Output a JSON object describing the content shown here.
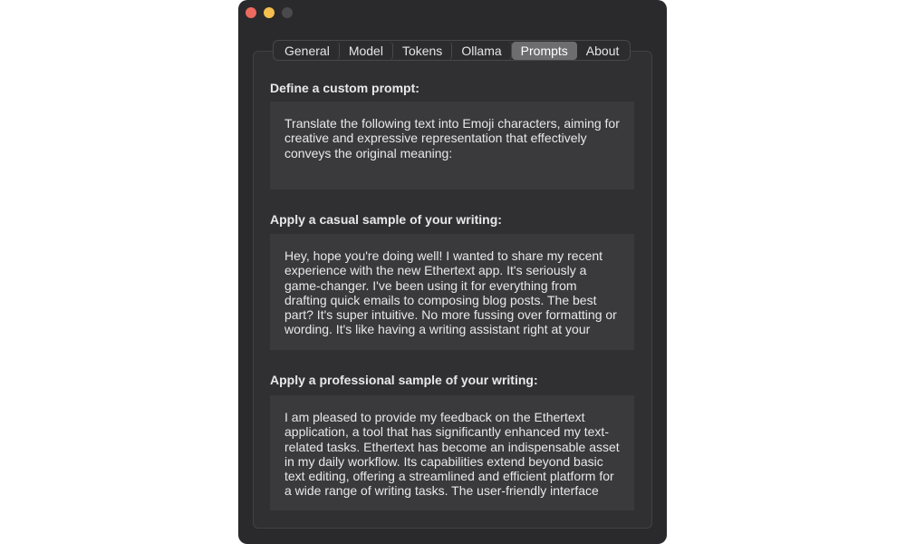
{
  "window": {
    "traffic_lights": [
      "close",
      "minimize",
      "zoom"
    ]
  },
  "tabs": [
    {
      "label": "General",
      "active": false
    },
    {
      "label": "Model",
      "active": false
    },
    {
      "label": "Tokens",
      "active": false
    },
    {
      "label": "Ollama",
      "active": false
    },
    {
      "label": "Prompts",
      "active": true
    },
    {
      "label": "About",
      "active": false
    }
  ],
  "sections": {
    "custom": {
      "label": "Define a custom prompt:",
      "text": "Translate the following text into Emoji characters, aiming for creative and expressive representation that effectively conveys the original meaning:"
    },
    "casual": {
      "label": "Apply a casual sample of your writing:",
      "text": "Hey, hope you're doing well! I wanted to share my recent experience with the new Ethertext app. It's seriously a game-changer. I've been using it for everything from drafting quick emails to composing blog posts. The best part? It's super intuitive. No more fussing over formatting or wording. It's like having a writing assistant right at your"
    },
    "professional": {
      "label": "Apply a professional sample of your writing:",
      "text": "I am pleased to provide my feedback on the Ethertext application, a tool that has significantly enhanced my text-related tasks. Ethertext has become an indispensable asset in my daily workflow. Its capabilities extend beyond basic text editing, offering a streamlined and efficient platform for a wide range of writing tasks. The user-friendly interface"
    }
  },
  "colors": {
    "window_bg": "#2a292c",
    "panel_bg": "#303033",
    "textbox_bg": "#3a3a3d",
    "active_tab_bg": "#6d6d70",
    "close": "#ed6a5e",
    "minimize": "#f4bf4f"
  }
}
